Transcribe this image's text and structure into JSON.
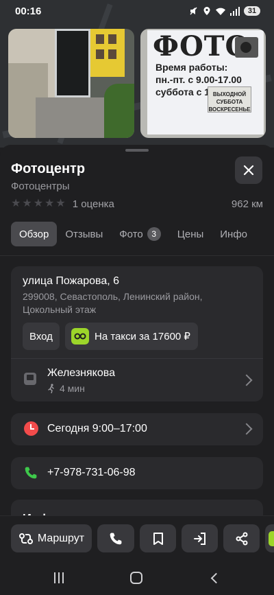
{
  "status_bar": {
    "time": "00:16",
    "battery": "31"
  },
  "photos": {
    "photo2_sign_title": "ФОТО",
    "photo2_hours_label": "Время работы:",
    "photo2_weekdays": "пн.-пт. с 9.00-17.00",
    "photo2_saturday": "суббота с 1",
    "photo2_plate_line1": "ВЫХОДНОЙ",
    "photo2_plate_line2": "СУББОТА",
    "photo2_plate_line3": "ВОСКРЕСЕНЬЕ"
  },
  "place": {
    "title": "Фотоцентр",
    "category": "Фотоцентры",
    "stars_filled": 0,
    "stars_total": 5,
    "rating_text": "1 оценка",
    "distance": "962 км"
  },
  "tabs": [
    {
      "label": "Обзор",
      "active": true
    },
    {
      "label": "Отзывы",
      "active": false
    },
    {
      "label": "Фото",
      "count": "3",
      "active": false
    },
    {
      "label": "Цены",
      "active": false
    },
    {
      "label": "Инфо",
      "active": false
    }
  ],
  "address": {
    "street": "улица Пожарова, 6",
    "detail": "299008, Севастополь, Ленинский район, Цокольный этаж",
    "entry_label": "Вход",
    "taxi_label": "На такси за 17600 ₽"
  },
  "metro": {
    "name": "Железнякова",
    "walk_time": "4 мин"
  },
  "hours": {
    "text": "Сегодня 9:00–17:00"
  },
  "phone": {
    "number": "+7-978-731-06-98"
  },
  "info": {
    "title": "Инфо"
  },
  "actions": {
    "route_label": "Маршрут"
  },
  "colors": {
    "background": "#1f1f21",
    "card": "#2a2a2d",
    "button": "#38383c",
    "taxi_green": "#9cd52a",
    "hours_red": "#f24b4b",
    "phone_green": "#3ec84b"
  }
}
